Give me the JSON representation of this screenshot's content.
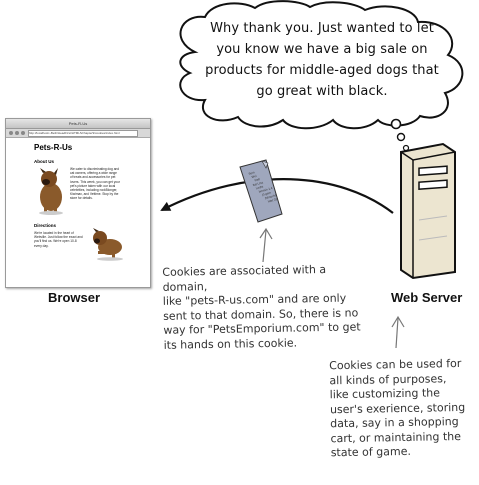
{
  "speech_bubble": {
    "text": "Why thank you. Just wanted to let you know we have a big sale on products for middle-aged dogs that go great with black."
  },
  "browser": {
    "window_title": "Pets-R-Us",
    "url": "http://localhost/~Beth/HeadFirst/HTML5/chapter9/cookies/index.html",
    "page_heading": "Pets-R-Us",
    "about_heading": "About Us",
    "about_text": "We cater to discriminating dog and cat owners, offering a wide range of treats and accessories for pet lovers. This week, you can get your pet's picture taken with our local celebrities, including rockBlonger, Kiwimax, and Vettime. Stop by the store for details.",
    "directions_heading": "Directions",
    "directions_text": "We're located in the heart of Webville. Just follow the exact and you'll find us. We're open 10-8 every day."
  },
  "labels": {
    "browser": "Browser",
    "server": "Web Server"
  },
  "cookie": {
    "lines": [
      "Sem",
      "Wei",
      "Reb",
      "ttal Lina",
      "Ledre",
      "bmmin 1.4",
      "(0 gem",
      "thfmoxhh",
      "Wet 03"
    ]
  },
  "notes": {
    "cookie_domain": "Cookies are associated with a domain,\nlike \"pets-R-us.com\" and are only\nsent to that domain. So, there is no\nway for \"PetsEmporium.com\" to get\nits hands on this cookie.",
    "cookie_uses": "Cookies can be used for\nall kinds of purposes,\nlike customizing the\nuser's exerience, storing\ndata, say in a shopping\ncart, or maintaining the\nstate of game."
  },
  "colors": {
    "server_body": "#ece5d0",
    "cookie_paper": "#9fa7bd",
    "arrow": "#111111"
  }
}
